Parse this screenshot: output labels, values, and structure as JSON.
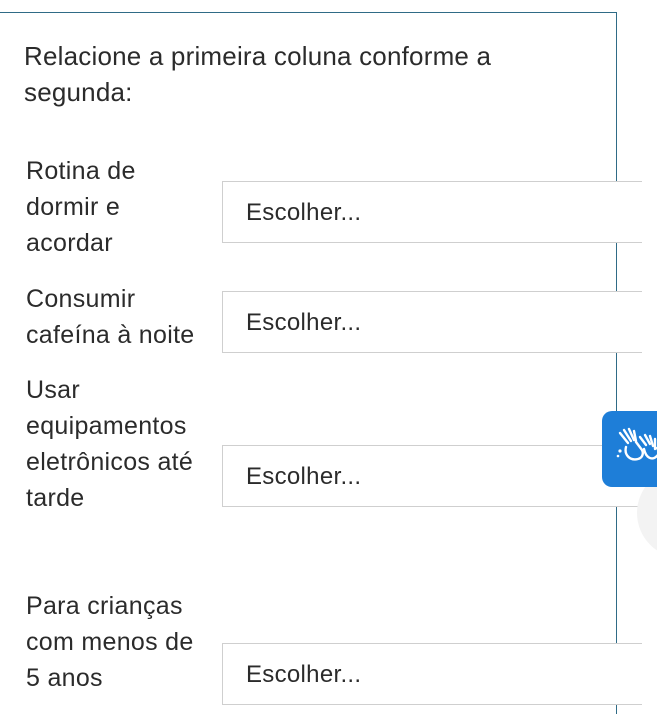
{
  "question": {
    "prompt": "Relacione a primeira coluna conforme a segunda:"
  },
  "rows": [
    {
      "label_lines": [
        "Rotina de",
        "dormir e",
        "acordar"
      ],
      "select_value": "Escolher..."
    },
    {
      "label_lines": [
        "Consumir",
        "cafeína à noite"
      ],
      "select_value": "Escolher..."
    },
    {
      "label_lines": [
        "Usar",
        "equipamentos",
        "eletrônicos até",
        "tarde"
      ],
      "select_value": "Escolher..."
    },
    {
      "label_lines": [
        "Para crianças",
        "com menos de",
        "5 anos"
      ],
      "select_value": "Escolher..."
    }
  ],
  "accessibility": {
    "icon": "sign-language-hands-icon",
    "color": "#1e7ed8"
  },
  "colors": {
    "border_accent": "#2f6b86",
    "select_border": "#cfcfcf",
    "text": "#2b2b2b"
  }
}
